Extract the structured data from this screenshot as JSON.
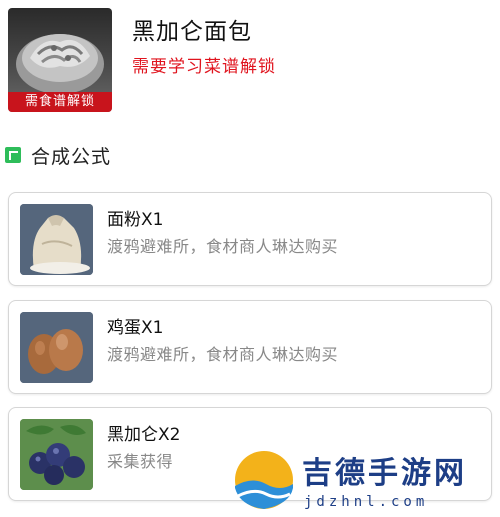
{
  "dish": {
    "title": "黑加仑面包",
    "lock_hint": "需要学习菜谱解锁",
    "badge": "需食谱解锁",
    "icon": "blackcurrant-bread-icon"
  },
  "section": {
    "title": "合成公式",
    "icon": "section-marker-icon"
  },
  "ingredients": [
    {
      "name": "面粉X1",
      "source": "渡鸦避难所，食材商人琳达购买",
      "icon": "flour-sack-icon"
    },
    {
      "name": "鸡蛋X1",
      "source": "渡鸦避难所，食材商人琳达购买",
      "icon": "eggs-icon"
    },
    {
      "name": "黑加仑X2",
      "source": "采集获得",
      "icon": "blackcurrant-icon"
    }
  ],
  "watermark": {
    "name": "吉德手游网",
    "url": "jdzhnl.com"
  },
  "colors": {
    "lock_red": "#e0141e",
    "badge_red": "#c8141c",
    "accent_green": "#2ebd5a",
    "watermark_blue": "#1d3e86"
  }
}
